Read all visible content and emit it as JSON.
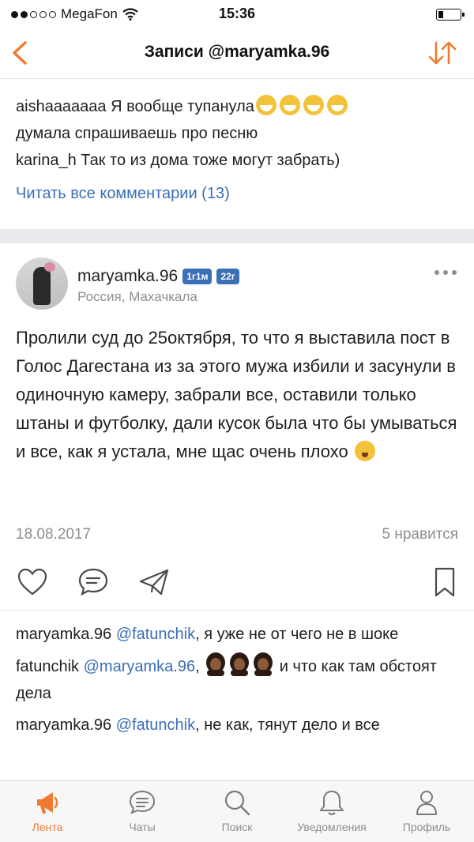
{
  "status_bar": {
    "carrier": "MegaFon",
    "time": "15:36"
  },
  "nav": {
    "title": "Записи @maryamka.96"
  },
  "top_comments": [
    {
      "user": "aishaaaaaaa",
      "text_lines": [
        "Я вообще тупанула",
        "думала спрашиваешь про песню"
      ]
    },
    {
      "user": "karina_h",
      "text": "Так то из дома тоже могут забрать)"
    }
  ],
  "read_all": "Читать все комментарии (13)",
  "post": {
    "username": "maryamka.96",
    "badges": [
      "1г1м",
      "22г"
    ],
    "location": "Россия, Махачкала",
    "text": "Пролили суд до 25октября, то что я выставила пост в Голос Дагестана из за этого мужа избили и засунули в одиночную камеру, забрали все, оставили только штаны и футболку, дали кусок была что бы умываться и все, как я устала, мне щас очень плохо",
    "date": "18.08.2017",
    "likes": "5 нравится"
  },
  "bottom_comments": [
    {
      "user": "maryamka.96",
      "mention": "@fatunchik",
      "text": ", я уже не от чего не в шоке"
    },
    {
      "user": "fatunchik",
      "mention": "@maryamka.96",
      "text_before": ",",
      "text": "и что как там обстоят дела"
    },
    {
      "user": "maryamka.96",
      "mention": "@fatunchik",
      "text": ", не как, тянут дело и все"
    }
  ],
  "tabs": [
    {
      "label": "Лента",
      "icon": "megaphone-icon",
      "active": true
    },
    {
      "label": "Чаты",
      "icon": "chat-bubble-icon",
      "active": false
    },
    {
      "label": "Поиск",
      "icon": "search-icon",
      "active": false
    },
    {
      "label": "Уведомления",
      "icon": "bell-icon",
      "active": false
    },
    {
      "label": "Профиль",
      "icon": "user-icon",
      "active": false
    }
  ],
  "colors": {
    "accent": "#f07b30",
    "link": "#3b6fb6",
    "muted": "#8e8e93"
  }
}
